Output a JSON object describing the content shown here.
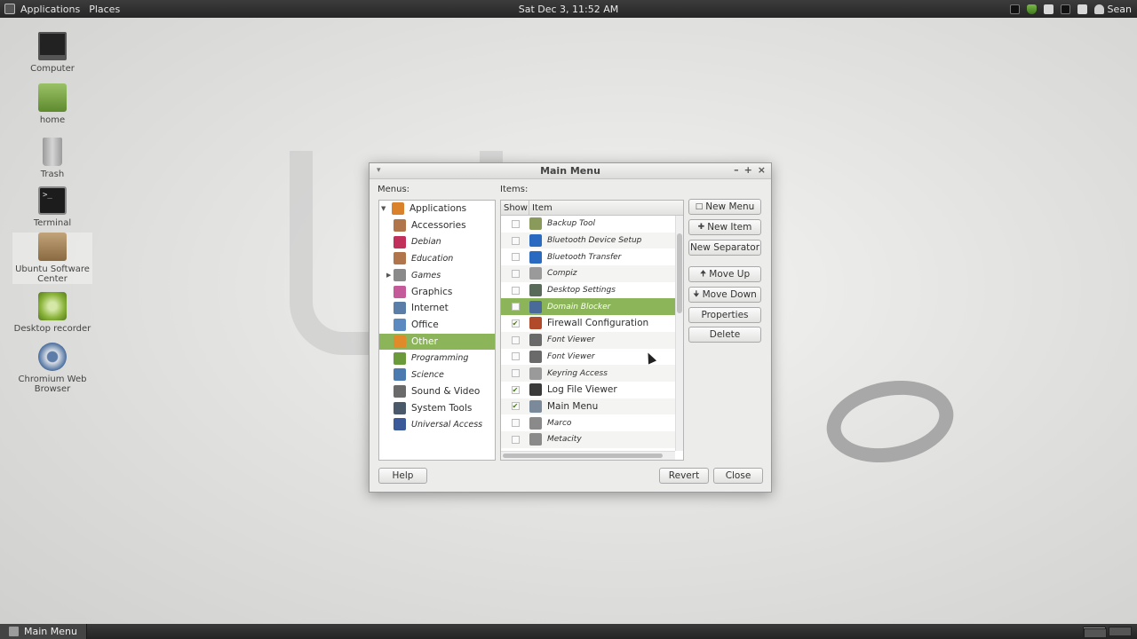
{
  "top_panel": {
    "menu_applications": "Applications",
    "menu_places": "Places",
    "clock": "Sat Dec  3, 11:52 AM",
    "user": "Sean"
  },
  "desktop_icons": [
    {
      "label": "Computer",
      "icon": "computer-icon"
    },
    {
      "label": "home",
      "icon": "home-folder-icon"
    },
    {
      "label": "Trash",
      "icon": "trash-icon"
    },
    {
      "label": "Terminal",
      "icon": "terminal-icon"
    },
    {
      "label": "Ubuntu Software Center",
      "icon": "software-center-icon"
    },
    {
      "label": "Desktop recorder",
      "icon": "desktop-recorder-icon"
    },
    {
      "label": "Chromium Web Browser",
      "icon": "chromium-icon"
    }
  ],
  "window": {
    "title": "Main Menu",
    "menus_label": "Menus:",
    "items_label": "Items:",
    "menus": [
      {
        "label": "Applications",
        "style": "norm",
        "expanded": true,
        "color": "#d9822b"
      },
      {
        "label": "Accessories",
        "style": "norm",
        "color": "#b0754a"
      },
      {
        "label": "Debian",
        "style": "italic",
        "color": "#c0305a"
      },
      {
        "label": "Education",
        "style": "italic",
        "color": "#b0754a"
      },
      {
        "label": "Games",
        "style": "italic",
        "collapsed": true,
        "color": "#8a8a8a"
      },
      {
        "label": "Graphics",
        "style": "norm",
        "color": "#c45a9a"
      },
      {
        "label": "Internet",
        "style": "norm",
        "color": "#5a7ea8"
      },
      {
        "label": "Office",
        "style": "norm",
        "color": "#5a8ac0"
      },
      {
        "label": "Other",
        "style": "norm",
        "selected": true,
        "color": "#e08a2a"
      },
      {
        "label": "Programming",
        "style": "italic",
        "color": "#6a9a3a"
      },
      {
        "label": "Science",
        "style": "italic",
        "color": "#4a7ab0"
      },
      {
        "label": "Sound & Video",
        "style": "norm",
        "color": "#6a6a6a"
      },
      {
        "label": "System Tools",
        "style": "norm",
        "color": "#4a5a6a"
      },
      {
        "label": "Universal Access",
        "style": "italic",
        "color": "#3a5a9a"
      }
    ],
    "items_header": {
      "show": "Show",
      "item": "Item"
    },
    "items": [
      {
        "label": "Backup Tool",
        "show": false,
        "style": "italic",
        "color": "#8a9a5a"
      },
      {
        "label": "Bluetooth Device Setup",
        "show": false,
        "style": "italic",
        "color": "#2a6ac0"
      },
      {
        "label": "Bluetooth Transfer",
        "show": false,
        "style": "italic",
        "color": "#2a6ac0"
      },
      {
        "label": "Compiz",
        "show": false,
        "style": "italic",
        "color": "#9a9a9a"
      },
      {
        "label": "Desktop Settings",
        "show": false,
        "style": "italic",
        "color": "#5a6a5a"
      },
      {
        "label": "Domain Blocker",
        "show": false,
        "style": "italic",
        "selected": true,
        "color": "#4a6a9a"
      },
      {
        "label": "Firewall Configuration",
        "show": true,
        "style": "norm",
        "color": "#b04a2a"
      },
      {
        "label": "Font Viewer",
        "show": false,
        "style": "italic",
        "color": "#6a6a6a"
      },
      {
        "label": "Font Viewer",
        "show": false,
        "style": "italic",
        "color": "#6a6a6a"
      },
      {
        "label": "Keyring Access",
        "show": false,
        "style": "italic",
        "color": "#9a9a9a"
      },
      {
        "label": "Log File Viewer",
        "show": true,
        "style": "norm",
        "color": "#3a3a3a"
      },
      {
        "label": "Main Menu",
        "show": true,
        "style": "norm",
        "color": "#7a8a9a"
      },
      {
        "label": "Marco",
        "show": false,
        "style": "italic",
        "color": "#8a8a8a"
      },
      {
        "label": "Metacity",
        "show": false,
        "style": "italic",
        "color": "#8a8a8a"
      }
    ],
    "buttons": {
      "new_menu": "New Menu",
      "new_item": "New Item",
      "new_separator": "New Separator",
      "move_up": "Move Up",
      "move_down": "Move Down",
      "properties": "Properties",
      "delete": "Delete",
      "help": "Help",
      "revert": "Revert",
      "close": "Close"
    }
  },
  "taskbar": {
    "task_label": "Main Menu"
  },
  "colors": {
    "selection": "#8cb55a",
    "mint_green": "#78b53a"
  }
}
